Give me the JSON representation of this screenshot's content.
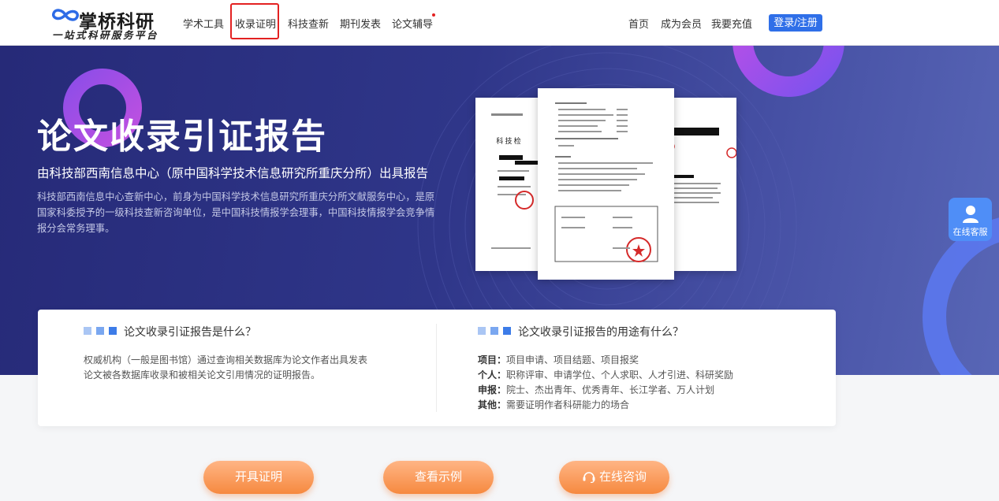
{
  "header": {
    "logo": {
      "name": "掌桥科研",
      "slogan": "一站式科研服务平台"
    },
    "nav": [
      {
        "label": "学术工具"
      },
      {
        "label": "收录证明",
        "active": true
      },
      {
        "label": "科技查新"
      },
      {
        "label": "期刊发表"
      },
      {
        "label": "论文辅导",
        "has_dot": true
      }
    ],
    "right": [
      {
        "label": "首页"
      },
      {
        "label": "成为会员"
      },
      {
        "label": "我要充值"
      }
    ],
    "login_label": "登录/注册"
  },
  "hero": {
    "title": "论文收录引证报告",
    "subtitle": "由科技部西南信息中心（原中国科学技术信息研究所重庆分所）出具报告",
    "description": "科技部西南信息中心查新中心，前身为中国科学技术信息研究所重庆分所文献服务中心，是原国家科委授予的一级科技查新咨询单位，是中国科技情报学会理事，中国科技情报学会竞争情报分会常务理事。",
    "doc_heading": "科 技 检"
  },
  "info": {
    "what": {
      "title": "论文收录引证报告是什么？",
      "text": "权威机构（一般是图书馆）通过查询相关数据库为论文作者出具发表论文被各数据库收录和被相关论文引用情况的证明报告。"
    },
    "uses": {
      "title": "论文收录引证报告的用途有什么？",
      "items": [
        {
          "label": "项目：",
          "text": "项目申请、项目结题、项目报奖"
        },
        {
          "label": "个人：",
          "text": "职称评审、申请学位、个人求职、人才引进、科研奖励"
        },
        {
          "label": "申报：",
          "text": "院士、杰出青年、优秀青年、长江学者、万人计划"
        },
        {
          "label": "其他：",
          "text": "需要证明作者科研能力的场合"
        }
      ]
    }
  },
  "actions": [
    {
      "label": "开具证明"
    },
    {
      "label": "查看示例"
    },
    {
      "label": "在线咨询",
      "icon": "headset-icon"
    }
  ],
  "service": {
    "label": "在线客服",
    "icon": "user-icon"
  },
  "colors": {
    "accent": "#2f6fe8",
    "highlight": "#e32121",
    "hero_bg": "#2f3689",
    "button": "#f6893f"
  }
}
